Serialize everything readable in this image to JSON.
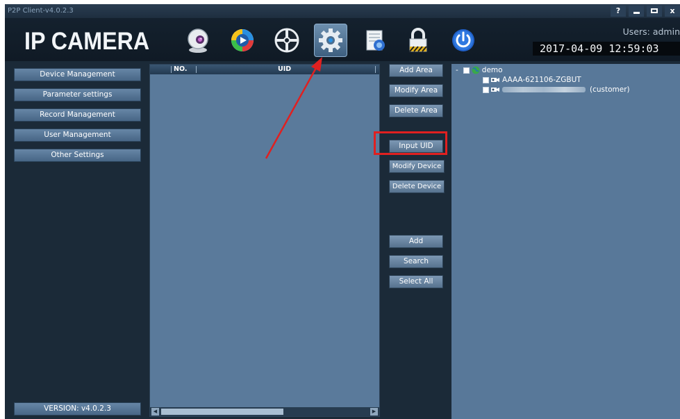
{
  "window": {
    "title": "P2P Client-v4.0.2.3"
  },
  "titlebar_controls": {
    "help": "?",
    "minimize": "",
    "maximize": "",
    "close": "x"
  },
  "header": {
    "logo": "IP CAMERA",
    "users": "Users: admin",
    "datetime": "2017-04-09  12:59:03",
    "toolbar_icons": [
      "camera-icon",
      "playback-icon",
      "ptz-icon",
      "settings-gear-icon",
      "log-icon",
      "lock-icon",
      "power-icon"
    ],
    "active_tool": "settings-gear-icon"
  },
  "left_menu": {
    "items": [
      "Device Management",
      "Parameter settings",
      "Record Management",
      "User Management",
      "Other Settings"
    ],
    "version": "VERSION: v4.0.2.3"
  },
  "device_table": {
    "columns": [
      "NO.",
      "UID"
    ],
    "rows": []
  },
  "middle_buttons": {
    "add_area": "Add Area",
    "modify_area": "Modify Area",
    "delete_area": "Delete Area",
    "input_uid": "Input UID",
    "modify_device": "Modify Device",
    "delete_device": "Delete Device",
    "add": "Add",
    "search": "Search",
    "select_all": "Select All"
  },
  "tree": {
    "expander": "-",
    "root_label": "demo",
    "children": [
      {
        "label": "AAAA-621106-ZGBUT",
        "suffix": ""
      },
      {
        "label": "",
        "suffix": "(customer)",
        "redacted": true
      }
    ]
  },
  "annotation": {
    "highlight_color": "#e02020",
    "highlighted_button": "Input UID",
    "points_to": "settings-gear-icon"
  },
  "colors": {
    "window_bg": "#1b2a38",
    "pane_bg": "#5a7a9b",
    "button_top": "#6786a6",
    "button_bottom": "#476686",
    "annotation_red": "#e02020"
  }
}
